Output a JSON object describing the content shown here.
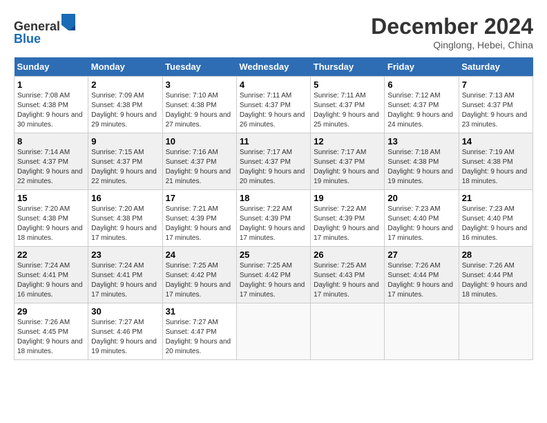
{
  "header": {
    "logo_line1": "General",
    "logo_line2": "Blue",
    "month": "December 2024",
    "location": "Qinglong, Hebei, China"
  },
  "weekdays": [
    "Sunday",
    "Monday",
    "Tuesday",
    "Wednesday",
    "Thursday",
    "Friday",
    "Saturday"
  ],
  "weeks": [
    [
      {
        "day": "1",
        "sunrise": "7:08 AM",
        "sunset": "4:38 PM",
        "daylight": "9 hours and 30 minutes."
      },
      {
        "day": "2",
        "sunrise": "7:09 AM",
        "sunset": "4:38 PM",
        "daylight": "9 hours and 29 minutes."
      },
      {
        "day": "3",
        "sunrise": "7:10 AM",
        "sunset": "4:38 PM",
        "daylight": "9 hours and 27 minutes."
      },
      {
        "day": "4",
        "sunrise": "7:11 AM",
        "sunset": "4:37 PM",
        "daylight": "9 hours and 26 minutes."
      },
      {
        "day": "5",
        "sunrise": "7:11 AM",
        "sunset": "4:37 PM",
        "daylight": "9 hours and 25 minutes."
      },
      {
        "day": "6",
        "sunrise": "7:12 AM",
        "sunset": "4:37 PM",
        "daylight": "9 hours and 24 minutes."
      },
      {
        "day": "7",
        "sunrise": "7:13 AM",
        "sunset": "4:37 PM",
        "daylight": "9 hours and 23 minutes."
      }
    ],
    [
      {
        "day": "8",
        "sunrise": "7:14 AM",
        "sunset": "4:37 PM",
        "daylight": "9 hours and 22 minutes."
      },
      {
        "day": "9",
        "sunrise": "7:15 AM",
        "sunset": "4:37 PM",
        "daylight": "9 hours and 22 minutes."
      },
      {
        "day": "10",
        "sunrise": "7:16 AM",
        "sunset": "4:37 PM",
        "daylight": "9 hours and 21 minutes."
      },
      {
        "day": "11",
        "sunrise": "7:17 AM",
        "sunset": "4:37 PM",
        "daylight": "9 hours and 20 minutes."
      },
      {
        "day": "12",
        "sunrise": "7:17 AM",
        "sunset": "4:37 PM",
        "daylight": "9 hours and 19 minutes."
      },
      {
        "day": "13",
        "sunrise": "7:18 AM",
        "sunset": "4:38 PM",
        "daylight": "9 hours and 19 minutes."
      },
      {
        "day": "14",
        "sunrise": "7:19 AM",
        "sunset": "4:38 PM",
        "daylight": "9 hours and 18 minutes."
      }
    ],
    [
      {
        "day": "15",
        "sunrise": "7:20 AM",
        "sunset": "4:38 PM",
        "daylight": "9 hours and 18 minutes."
      },
      {
        "day": "16",
        "sunrise": "7:20 AM",
        "sunset": "4:38 PM",
        "daylight": "9 hours and 17 minutes."
      },
      {
        "day": "17",
        "sunrise": "7:21 AM",
        "sunset": "4:39 PM",
        "daylight": "9 hours and 17 minutes."
      },
      {
        "day": "18",
        "sunrise": "7:22 AM",
        "sunset": "4:39 PM",
        "daylight": "9 hours and 17 minutes."
      },
      {
        "day": "19",
        "sunrise": "7:22 AM",
        "sunset": "4:39 PM",
        "daylight": "9 hours and 17 minutes."
      },
      {
        "day": "20",
        "sunrise": "7:23 AM",
        "sunset": "4:40 PM",
        "daylight": "9 hours and 17 minutes."
      },
      {
        "day": "21",
        "sunrise": "7:23 AM",
        "sunset": "4:40 PM",
        "daylight": "9 hours and 16 minutes."
      }
    ],
    [
      {
        "day": "22",
        "sunrise": "7:24 AM",
        "sunset": "4:41 PM",
        "daylight": "9 hours and 16 minutes."
      },
      {
        "day": "23",
        "sunrise": "7:24 AM",
        "sunset": "4:41 PM",
        "daylight": "9 hours and 17 minutes."
      },
      {
        "day": "24",
        "sunrise": "7:25 AM",
        "sunset": "4:42 PM",
        "daylight": "9 hours and 17 minutes."
      },
      {
        "day": "25",
        "sunrise": "7:25 AM",
        "sunset": "4:42 PM",
        "daylight": "9 hours and 17 minutes."
      },
      {
        "day": "26",
        "sunrise": "7:25 AM",
        "sunset": "4:43 PM",
        "daylight": "9 hours and 17 minutes."
      },
      {
        "day": "27",
        "sunrise": "7:26 AM",
        "sunset": "4:44 PM",
        "daylight": "9 hours and 17 minutes."
      },
      {
        "day": "28",
        "sunrise": "7:26 AM",
        "sunset": "4:44 PM",
        "daylight": "9 hours and 18 minutes."
      }
    ],
    [
      {
        "day": "29",
        "sunrise": "7:26 AM",
        "sunset": "4:45 PM",
        "daylight": "9 hours and 18 minutes."
      },
      {
        "day": "30",
        "sunrise": "7:27 AM",
        "sunset": "4:46 PM",
        "daylight": "9 hours and 19 minutes."
      },
      {
        "day": "31",
        "sunrise": "7:27 AM",
        "sunset": "4:47 PM",
        "daylight": "9 hours and 20 minutes."
      },
      null,
      null,
      null,
      null
    ]
  ]
}
